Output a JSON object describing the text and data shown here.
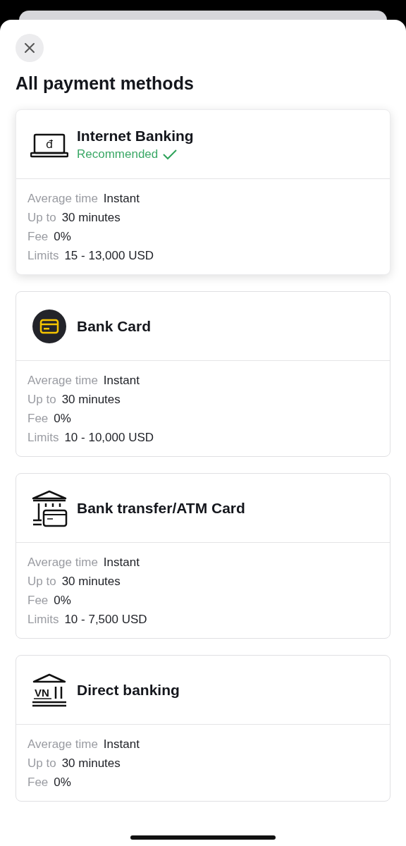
{
  "sheet": {
    "title": "All payment methods"
  },
  "methods": [
    {
      "name": "Internet Banking",
      "kind": "laptop",
      "icon_text": "đ",
      "recommended": "Recommended",
      "selected": true,
      "details": [
        {
          "label": "Average time",
          "value": "Instant"
        },
        {
          "label": "Up to",
          "value": "30 minutes"
        },
        {
          "label": "Fee",
          "value": "0%"
        },
        {
          "label": "Limits",
          "value": "15 - 13,000 USD"
        }
      ]
    },
    {
      "name": "Bank Card",
      "kind": "card",
      "selected": false,
      "details": [
        {
          "label": "Average time",
          "value": "Instant"
        },
        {
          "label": "Up to",
          "value": "30 minutes"
        },
        {
          "label": "Fee",
          "value": "0%"
        },
        {
          "label": "Limits",
          "value": "10 - 10,000 USD"
        }
      ]
    },
    {
      "name": "Bank transfer/ATM Card",
      "kind": "bank-card",
      "selected": false,
      "details": [
        {
          "label": "Average time",
          "value": "Instant"
        },
        {
          "label": "Up to",
          "value": "30 minutes"
        },
        {
          "label": "Fee",
          "value": "0%"
        },
        {
          "label": "Limits",
          "value": "10 - 7,500 USD"
        }
      ]
    },
    {
      "name": "Direct banking",
      "kind": "bank",
      "icon_text": "VN",
      "selected": false,
      "details": [
        {
          "label": "Average time",
          "value": "Instant"
        },
        {
          "label": "Up to",
          "value": "30 minutes"
        },
        {
          "label": "Fee",
          "value": "0%"
        }
      ]
    }
  ]
}
